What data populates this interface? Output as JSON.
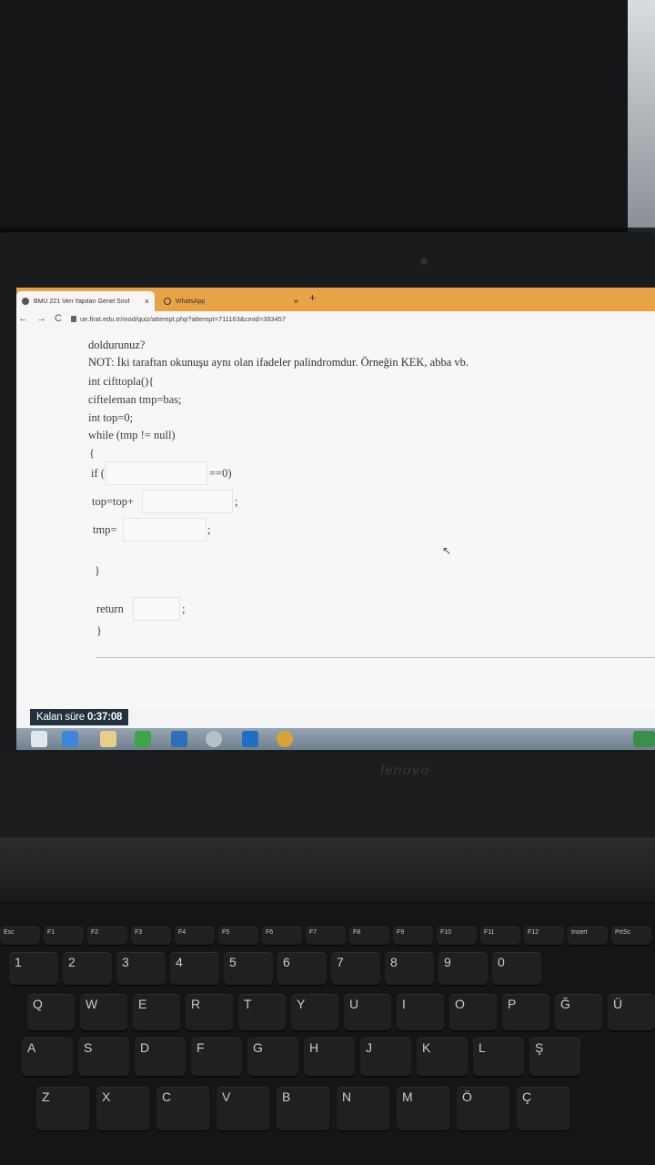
{
  "browser": {
    "tabs": [
      {
        "label": "BMÜ 221 Veri Yapıları Genel Sınıf",
        "close": "×"
      },
      {
        "label": "WhatsApp",
        "close": "×"
      }
    ],
    "new_tab": "+",
    "url": "ue.firat.edu.tr/mod/quiz/attempt.php?attempt=711163&cmid=393457"
  },
  "question": {
    "intro": "doldurunuz?",
    "note": "NOT: İki taraftan okunuşu aynı olan ifadeler palindromdur. Örneğin KEK, abba vb.",
    "code": {
      "l1": "int cifttopla(){",
      "l2": "ciftelеman tmp=bas;",
      "l3": "int top=0;",
      "l4": "while (tmp != null)",
      "l5": "{",
      "if_prefix": "if (",
      "if_suffix": "==0)",
      "top_prefix": "top=top+",
      "top_suffix": ";",
      "tmp_prefix": "tmp=",
      "tmp_suffix": ";",
      "close_brace": "}",
      "return_prefix": "return",
      "return_suffix": ";",
      "final_brace": "}"
    }
  },
  "timer": {
    "label": "Kalan süre",
    "value": "0:37:08"
  },
  "laptop": {
    "brand": "lenovo"
  },
  "keyboard": {
    "fn_row": [
      "Esc",
      "F1",
      "F2",
      "F3",
      "F4",
      "F5",
      "F6",
      "F7",
      "F8",
      "F9",
      "F10",
      "F11",
      "F12",
      "Insert",
      "PrtSc"
    ],
    "num_row": [
      "1",
      "2",
      "3",
      "4",
      "5",
      "6",
      "7",
      "8",
      "9",
      "0"
    ],
    "top_row": [
      "Q",
      "W",
      "E",
      "R",
      "T",
      "Y",
      "U",
      "I",
      "O",
      "P",
      "Ğ",
      "Ü"
    ],
    "mid_row": [
      "A",
      "S",
      "D",
      "F",
      "G",
      "H",
      "J",
      "K",
      "L",
      "Ş"
    ],
    "bot_row": [
      "Z",
      "X",
      "C",
      "V",
      "B",
      "N",
      "M",
      "Ö",
      "Ç"
    ]
  },
  "colors": {
    "tabbar": "#e9a347",
    "timer_bg": "#23303f",
    "taskbar": "#7f8f9d"
  }
}
